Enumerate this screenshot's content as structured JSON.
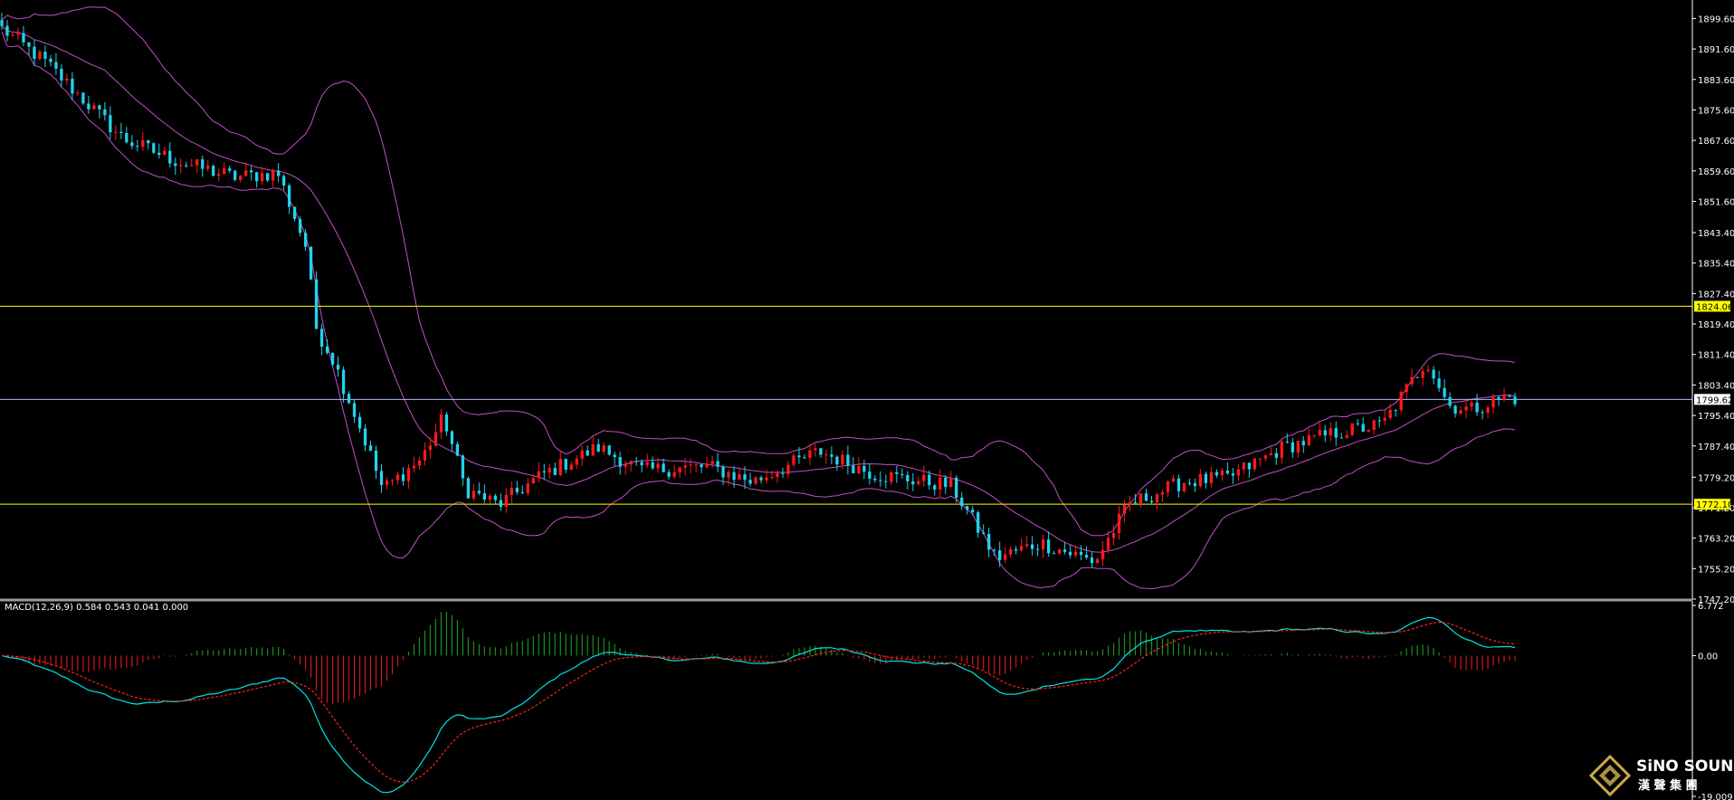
{
  "chart_data": [
    {
      "type": "candlestick",
      "title": "",
      "ylim": [
        1747.2,
        1903.5
      ],
      "y_ticks": [
        "1899.60",
        "1891.60",
        "1883.60",
        "1875.60",
        "1867.60",
        "1859.60",
        "1851.60",
        "1843.40",
        "1835.40",
        "1827.40",
        "1819.40",
        "1811.40",
        "1803.40",
        "1795.40",
        "1787.40",
        "1779.20",
        "1771.20",
        "1763.20",
        "1755.20",
        "1747.20"
      ],
      "grid": false,
      "overlays": [
        "Bollinger Bands"
      ],
      "horizontal_lines": [
        {
          "value": 1824.06,
          "label": "1824.06",
          "color": "#ffff00"
        },
        {
          "value": 1799.62,
          "label": "1799.62",
          "color": "#ffffff"
        },
        {
          "value": 1772.1,
          "label": "1772.10",
          "color": "#ffff00"
        }
      ],
      "key_points": [
        {
          "x": 0,
          "close": 1897
        },
        {
          "x": 40,
          "close": 1888
        },
        {
          "x": 110,
          "close": 1868
        },
        {
          "x": 160,
          "close": 1862
        },
        {
          "x": 210,
          "close": 1858
        },
        {
          "x": 250,
          "close": 1859
        },
        {
          "x": 275,
          "close": 1840
        },
        {
          "x": 285,
          "close": 1818
        },
        {
          "x": 300,
          "close": 1810
        },
        {
          "x": 330,
          "close": 1788
        },
        {
          "x": 345,
          "close": 1776
        },
        {
          "x": 380,
          "close": 1784
        },
        {
          "x": 400,
          "close": 1795
        },
        {
          "x": 420,
          "close": 1776
        },
        {
          "x": 450,
          "close": 1772
        },
        {
          "x": 490,
          "close": 1780
        },
        {
          "x": 540,
          "close": 1787
        },
        {
          "x": 580,
          "close": 1781
        },
        {
          "x": 640,
          "close": 1782
        },
        {
          "x": 680,
          "close": 1778
        },
        {
          "x": 740,
          "close": 1786
        },
        {
          "x": 790,
          "close": 1780
        },
        {
          "x": 860,
          "close": 1777
        },
        {
          "x": 900,
          "close": 1758
        },
        {
          "x": 940,
          "close": 1762
        },
        {
          "x": 990,
          "close": 1757
        },
        {
          "x": 1020,
          "close": 1772
        },
        {
          "x": 1070,
          "close": 1778
        },
        {
          "x": 1110,
          "close": 1779
        },
        {
          "x": 1160,
          "close": 1787
        },
        {
          "x": 1210,
          "close": 1791
        },
        {
          "x": 1250,
          "close": 1793
        },
        {
          "x": 1290,
          "close": 1810
        },
        {
          "x": 1310,
          "close": 1798
        },
        {
          "x": 1330,
          "close": 1797
        },
        {
          "x": 1360,
          "close": 1800
        }
      ]
    },
    {
      "type": "macd",
      "title": "",
      "ylim": [
        -19.009,
        6.772
      ],
      "y_ticks": [
        "6.772",
        "0.00",
        "-19.009"
      ],
      "series": [
        {
          "name": "MACD",
          "color": "#00e5e5"
        },
        {
          "name": "Signal",
          "color": "#ff2020"
        },
        {
          "name": "Histogram",
          "color": "#1b8f1b"
        }
      ]
    }
  ],
  "macd_header": "MACD(12,26,9) 0.584 0.543 0.041 0.000",
  "colors": {
    "background": "#000000",
    "bull_candle": "#ff1a1a",
    "bear_candle": "#22d3ee",
    "bollinger": "#c050c8",
    "level_line": "#ffff00",
    "price_line": "#b8b8ff",
    "axis_text": "#ffffff"
  },
  "logo": {
    "brand": "SiNO SOUND",
    "brand_cn": "漢 聲 集 團",
    "icon": "diamond-logo-icon"
  }
}
